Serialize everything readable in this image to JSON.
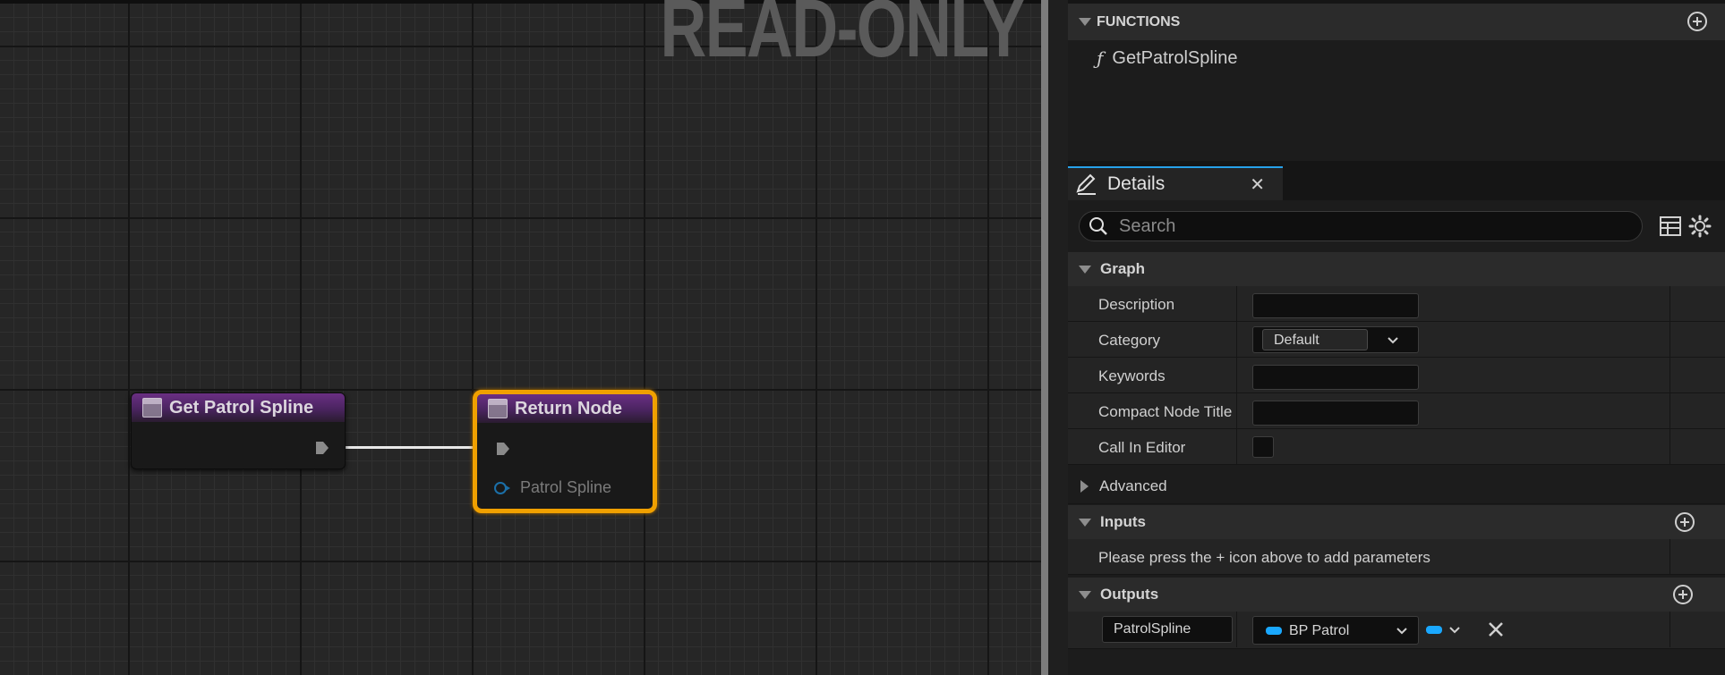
{
  "graph": {
    "watermark": "READ-ONLY",
    "nodes": [
      {
        "title": "Get Patrol Spline"
      },
      {
        "title": "Return Node",
        "pin_label": "Patrol Spline"
      }
    ]
  },
  "functions": {
    "header": "FUNCTIONS",
    "items": [
      "GetPatrolSpline"
    ]
  },
  "details": {
    "tab_label": "Details",
    "search_placeholder": "Search",
    "graph_section": {
      "header": "Graph",
      "rows": [
        {
          "label": "Description",
          "value": ""
        },
        {
          "label": "Category",
          "value": "Default"
        },
        {
          "label": "Keywords",
          "value": ""
        },
        {
          "label": "Compact Node Title",
          "value": ""
        },
        {
          "label": "Call In Editor",
          "checked": false
        }
      ],
      "advanced_label": "Advanced"
    },
    "inputs": {
      "header": "Inputs",
      "hint": "Please press the + icon above to add parameters"
    },
    "outputs": {
      "header": "Outputs",
      "param_name": "PatrolSpline",
      "param_type": "BP Patrol",
      "type_color": "#1aa8ff"
    }
  },
  "colors": {
    "node_header": "#6a2f83",
    "selected_outline": "#f0a000",
    "tab_accent": "#26a1ea"
  }
}
